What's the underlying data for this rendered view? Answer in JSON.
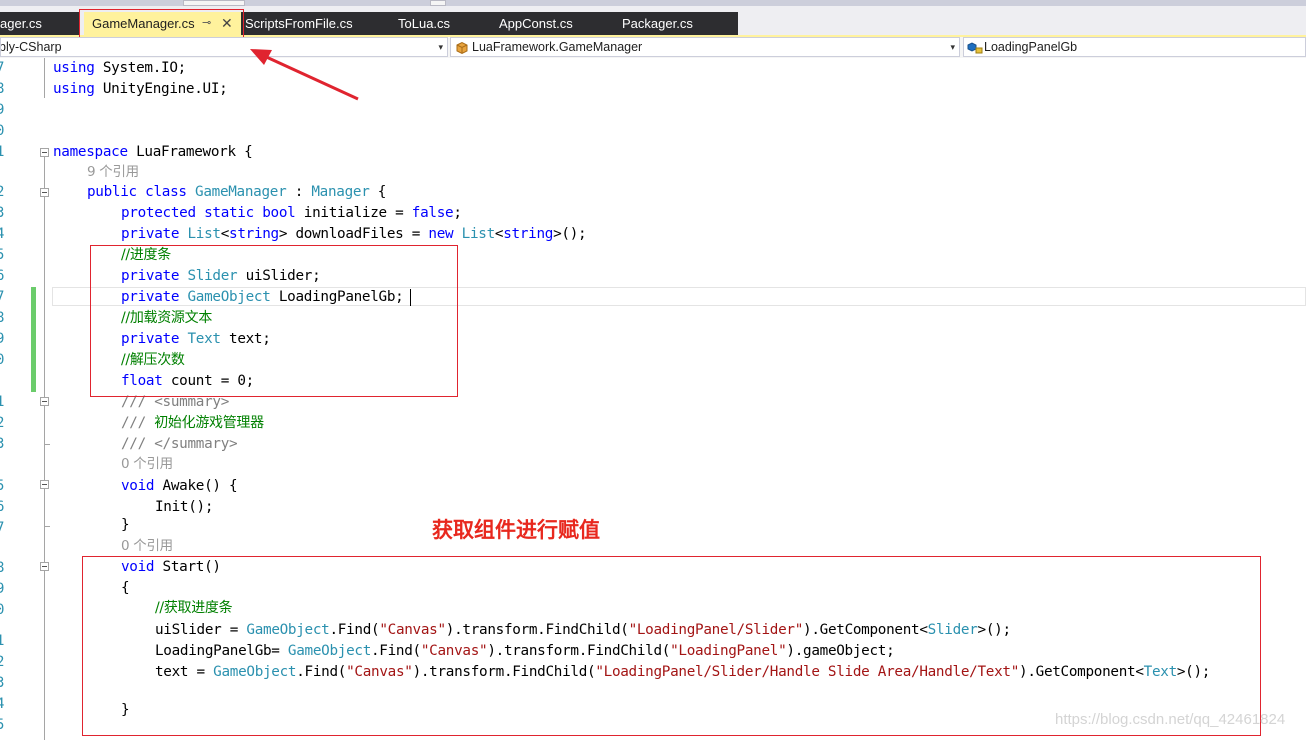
{
  "tabs": [
    {
      "label": "ager.cs",
      "active": false
    },
    {
      "label": "GameManager.cs",
      "active": true
    },
    {
      "label": "ScriptsFromFile.cs",
      "active": false
    },
    {
      "label": "ToLua.cs",
      "active": false
    },
    {
      "label": "AppConst.cs",
      "active": false
    },
    {
      "label": "Packager.cs",
      "active": false
    }
  ],
  "tab_icons": {
    "pin": "⊸",
    "close": "✕"
  },
  "navbar": {
    "project": "bly-CSharp",
    "type": "LuaFramework.GameManager",
    "member": "LoadingPanelGb",
    "dropdown_glyph": "▾"
  },
  "line_numbers": [
    "7",
    "8",
    "9",
    "0",
    "",
    "1",
    "",
    "2",
    "3",
    "4",
    "5",
    "6",
    "7",
    "8",
    "9",
    "0",
    "1",
    "2",
    "3",
    "4",
    "",
    "5",
    "6",
    "7",
    "",
    "8",
    "9",
    "0",
    "1",
    "2",
    "3",
    "4",
    "5",
    "6"
  ],
  "code": {
    "l_using1": {
      "kw": "using",
      "rest": " System.IO;"
    },
    "l_using2": {
      "kw": "using",
      "rest": " UnityEngine.UI;"
    },
    "l_ns": {
      "kw": "namespace",
      "rest": " LuaFramework {"
    },
    "ref9": "9 个引用",
    "l_class": {
      "kw1": "public",
      "kw2": " class ",
      "ty": "GameManager",
      "mid": " : ",
      "ty2": "Manager",
      "end": " {"
    },
    "l_init": {
      "kw": "protected static bool",
      "mid": " initialize = ",
      "kw2": "false",
      "end": ";"
    },
    "l_dl": {
      "kw": "private",
      "ty": " List",
      "p1": "<",
      "kw2": "string",
      "p2": "> downloadFiles = ",
      "kw3": "new",
      "ty2": " List",
      "p3": "<",
      "kw4": "string",
      "p4": ">();"
    },
    "c_slider": "//进度条",
    "l_slider": {
      "kw": "private",
      "ty": " Slider",
      "rest": " uiSlider;"
    },
    "l_gb": {
      "kw": "private",
      "ty": " GameObject",
      "rest": " LoadingPanelGb;"
    },
    "c_text": "//加载资源文本",
    "l_text": {
      "kw": "private",
      "ty": " Text",
      "rest": " text;"
    },
    "c_count": "//解压次数",
    "l_count": {
      "kw": "float",
      "rest": " count = 0;"
    },
    "d1": {
      "slash": "/// ",
      "tag": "<summary>"
    },
    "d2": {
      "slash": "/// ",
      "txt": "初始化游戏管理器"
    },
    "d3": {
      "slash": "/// ",
      "tag": "</summary>"
    },
    "ref0a": "0 个引用",
    "l_awake": {
      "kw": "void",
      "rest": " Awake() {"
    },
    "l_initcall": "Init();",
    "l_close1": "}",
    "ref0b": "0 个引用",
    "l_start": {
      "kw": "void",
      "rest": " Start()"
    },
    "l_open": "{",
    "c_find": "//获取进度条",
    "l_f1": {
      "a": "uiSlider = ",
      "ty": "GameObject",
      "b": ".Find(",
      "s1": "\"Canvas\"",
      "c": ").transform.FindChild(",
      "s2": "\"LoadingPanel/Slider\"",
      "d": ").GetComponent<",
      "ty2": "Slider",
      "e": ">();"
    },
    "l_f2": {
      "a": "LoadingPanelGb= ",
      "ty": "GameObject",
      "b": ".Find(",
      "s1": "\"Canvas\"",
      "c": ").transform.FindChild(",
      "s2": "\"LoadingPanel\"",
      "d": ").gameObject;"
    },
    "l_f3": {
      "a": "text = ",
      "ty": "GameObject",
      "b": ".Find(",
      "s1": "\"Canvas\"",
      "c": ").transform.FindChild(",
      "s2": "\"LoadingPanel/Slider/Handle Slide Area/Handle/Text\"",
      "d": ").GetComponent<",
      "ty2": "Text",
      "e": ">();"
    },
    "l_close2": "}"
  },
  "annotation": "获取组件进行赋值",
  "watermark": "https://blog.csdn.net/qq_42461824",
  "colors": {
    "keyword": "#0000ff",
    "type": "#2b91af",
    "string": "#a31515",
    "comment": "#008000",
    "highlight": "#e0242f"
  }
}
